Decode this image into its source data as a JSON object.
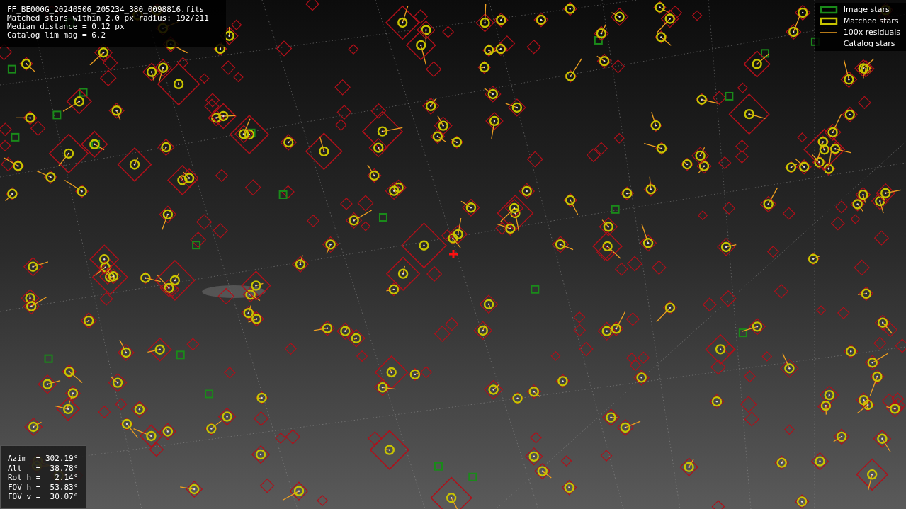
{
  "info": {
    "lines": [
      "FF_BE000G_20240506_205234_380_0098816.fits",
      "Matched stars within 2.0 px radius: 192/211",
      "Median distance = 0.12 px",
      "Catalog lim mag = 6.2"
    ]
  },
  "legend": [
    {
      "label": "Image stars",
      "kind": "image"
    },
    {
      "label": "Matched stars",
      "kind": "matched"
    },
    {
      "label": "100x residuals",
      "kind": "residual"
    },
    {
      "label": "Catalog stars",
      "kind": "catalog"
    }
  ],
  "pointing": {
    "lines": [
      "Azim  = 302.19°",
      "Alt   =  38.78°",
      "Rot h =   2.14°",
      "FOV h =  53.83°",
      "FOV v =  30.07°"
    ]
  }
}
